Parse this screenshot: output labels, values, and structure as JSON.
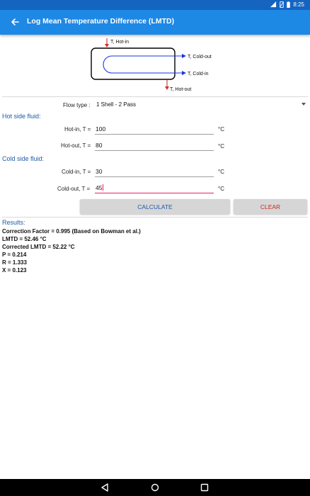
{
  "status_bar": {
    "time": "8:25",
    "icons": [
      "wifi-icon",
      "no-sim-icon",
      "battery-icon"
    ]
  },
  "app_bar": {
    "title": "Log Mean Temperature Difference (LMTD)",
    "back_icon": "arrow-back-icon"
  },
  "diagram": {
    "hot_in": "T, Hot-in",
    "cold_out": "T, Cold-out",
    "cold_in": "T, Cold-in",
    "hot_out": "T, Hot-out"
  },
  "flow_type": {
    "label": "Flow type :",
    "selected": "1 Shell - 2 Pass"
  },
  "hot_side": {
    "heading": "Hot side fluid:",
    "hot_in": {
      "label": "Hot-in, T =",
      "value": "100",
      "unit": "°C"
    },
    "hot_out": {
      "label": "Hot-out, T =",
      "value": "80",
      "unit": "°C"
    }
  },
  "cold_side": {
    "heading": "Cold side fluid:",
    "cold_in": {
      "label": "Cold-in, T =",
      "value": "30",
      "unit": "°C"
    },
    "cold_out": {
      "label": "Cold-out, T =",
      "value": "45",
      "unit": "°C"
    }
  },
  "buttons": {
    "calculate": "CALCULATE",
    "clear": "CLEAR"
  },
  "results": {
    "heading": "Results:",
    "lines": [
      "Correction Factor = 0.995 (Based on Bowman et al.)",
      "LMTD = 52.46 °C",
      "Corrected LMTD = 52.22 °C",
      "P = 0.214",
      "R = 1.333",
      "X = 0.123"
    ]
  },
  "colors": {
    "app_bar": "#1e88e5",
    "status_bar": "#1565c0",
    "accent_text": "#1e5aa8",
    "clear_text": "#c62828",
    "focus_underline": "#e91e63",
    "flow_lines": "#1a35e0",
    "hot_arrows": "#d32f2f"
  },
  "nav_icons": [
    "back-triangle-icon",
    "home-circle-icon",
    "recents-square-icon"
  ]
}
